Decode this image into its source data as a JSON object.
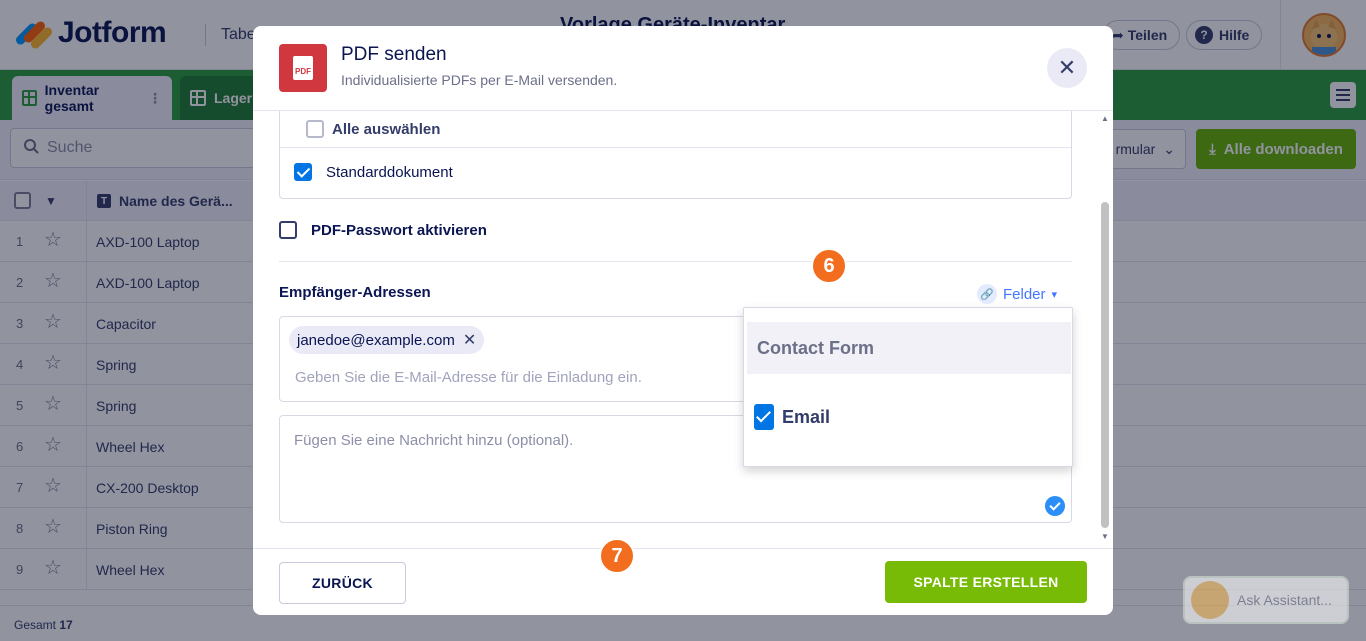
{
  "app": {
    "logo_text": "Jotform",
    "table_tab": "Tabe",
    "doc_title": "Vorlage Geräte-Inventar",
    "share_label": "Teilen",
    "help_label": "Hilfe"
  },
  "sheet_tabs": [
    {
      "label": "Inventar gesamt"
    },
    {
      "label": "Lagerl"
    }
  ],
  "toolbar": {
    "search_placeholder": "Suche",
    "form_label": "rmular",
    "download_label": "Alle downloaden"
  },
  "table": {
    "name_header": "Name des Gerä...",
    "rows": [
      {
        "num": "1",
        "name": "AXD-100 Laptop"
      },
      {
        "num": "2",
        "name": "AXD-100 Laptop"
      },
      {
        "num": "3",
        "name": "Capacitor"
      },
      {
        "num": "4",
        "name": "Spring"
      },
      {
        "num": "5",
        "name": "Spring"
      },
      {
        "num": "6",
        "name": "Wheel Hex"
      },
      {
        "num": "7",
        "name": "CX-200 Desktop"
      },
      {
        "num": "8",
        "name": "Piston Ring"
      },
      {
        "num": "9",
        "name": "Wheel Hex"
      }
    ],
    "footer_label": "Gesamt",
    "footer_count": "17"
  },
  "assistant_label": "Ask Assistant...",
  "modal": {
    "title": "PDF senden",
    "subtitle": "Individualisierte PDFs per E-Mail versenden.",
    "pdf_icon_text": "PDF",
    "select_all_label": "Alle auswählen",
    "standard_doc_label": "Standarddokument",
    "password_label": "PDF-Passwort aktivieren",
    "recipients_label": "Empfänger-Adressen",
    "fields_label": "Felder",
    "email_chip": "janedoe@example.com",
    "email_placeholder": "Geben Sie die E-Mail-Adresse für die Einladung ein.",
    "message_placeholder": "Fügen Sie eine Nachricht hinzu (optional).",
    "back_label": "ZURÜCK",
    "create_label": "SPALTE ERSTELLEN"
  },
  "dropdown": {
    "group_label": "Contact Form",
    "item_label": "Email"
  },
  "steps": {
    "step6": "6",
    "step7": "7"
  },
  "colors": {
    "brand_green": "#2a9d3f",
    "accent_button": "#78bb07",
    "step_badge": "#f26d1d",
    "pdf_red": "#d0373e",
    "link_blue": "#4277ff"
  }
}
